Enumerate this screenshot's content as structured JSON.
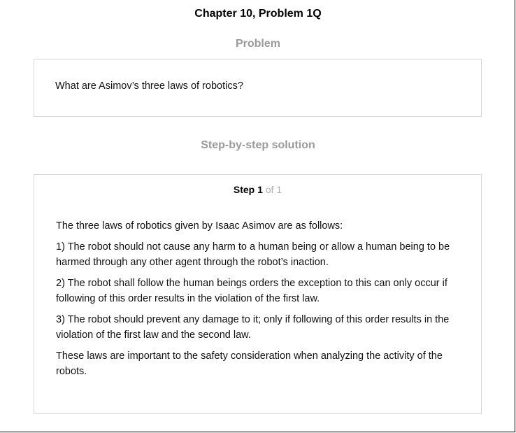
{
  "header": {
    "chapter_title": "Chapter 10, Problem 1Q"
  },
  "problem": {
    "heading": "Problem",
    "text": "What are Asimov’s three laws of robotics?"
  },
  "solution": {
    "heading": "Step-by-step solution",
    "step_label": "Step 1",
    "step_of": " of 1",
    "paragraphs": [
      "The three laws of robotics given by Isaac Asimov are as follows:",
      "1) The robot should not cause any harm to a human being or allow a human being to be harmed through any other agent through the robot’s inaction.",
      "2) The robot shall follow the human beings orders the exception to this can only occur if following of this order results in the violation of the first law.",
      "3) The robot should prevent any damage to it; only if following of this order results in the violation of the first law and the second law.",
      "These laws are important to the safety consideration when analyzing the activity of the robots."
    ]
  }
}
